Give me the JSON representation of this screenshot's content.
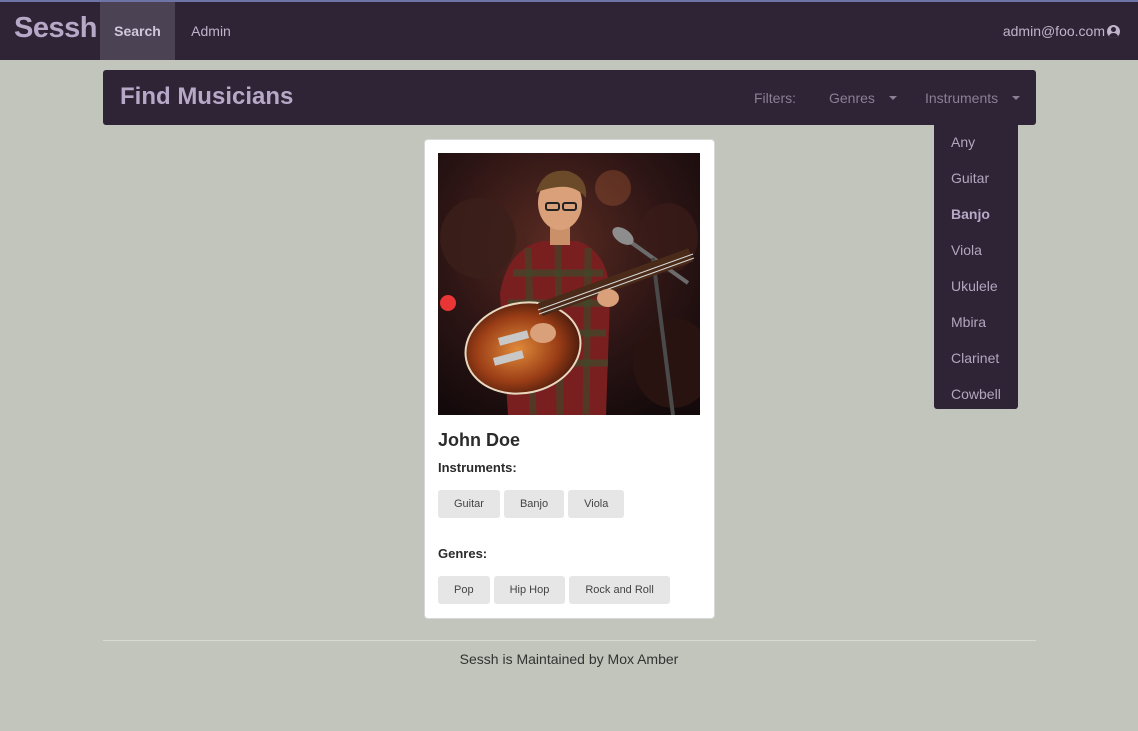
{
  "navbar": {
    "brand": "Sessh",
    "links": [
      "Search",
      "Admin"
    ],
    "user_email": "admin@foo.com"
  },
  "header": {
    "title": "Find Musicians",
    "filters_label": "Filters:",
    "genres_label": "Genres",
    "instruments_label": "Instruments"
  },
  "instruments_menu": {
    "items": [
      "Any",
      "Guitar",
      "Banjo",
      "Viola",
      "Ukulele",
      "Mbira",
      "Clarinet",
      "Cowbell"
    ],
    "highlighted": "Banjo"
  },
  "musician": {
    "name": "John Doe",
    "instruments_label": "Instruments:",
    "instruments": [
      "Guitar",
      "Banjo",
      "Viola"
    ],
    "genres_label": "Genres:",
    "genres": [
      "Pop",
      "Hip Hop",
      "Rock and Roll"
    ]
  },
  "footer": {
    "text": "Sessh is Maintained by Mox Amber"
  },
  "colors": {
    "page_bg": "#c2c5bb",
    "nav_bg": "#2f2336",
    "accent_text": "#b8a8c8"
  },
  "icons": {
    "user": "user-circle-icon",
    "caret": "caret-down-icon"
  }
}
